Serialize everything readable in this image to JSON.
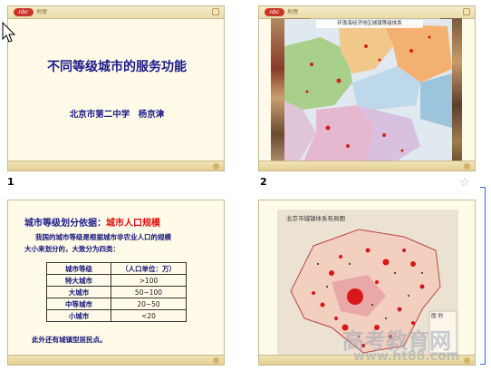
{
  "slides": [
    {
      "number": "1",
      "top_text": "地理",
      "logo": "nbc",
      "title": "不同等级城市的服务功能",
      "subtitle": "北京市第二中学　杨京津"
    },
    {
      "number": "2",
      "top_text": "地理",
      "logo": "nbc",
      "map_title": "环渤海经济地区城镇等级体系"
    },
    {
      "top_text": "地理",
      "logo": "nbc",
      "heading_prefix": "城市等级划分依据：",
      "heading_highlight": "城市人口规模",
      "para_line1": "我国的城市等级是根据城市非农业人口的规模",
      "para_line2": "大小来划分的，大致分为四类：",
      "table": {
        "header": [
          "城市等级",
          "（人口单位：万）"
        ],
        "rows": [
          [
            "特大城市",
            ">100"
          ],
          [
            "大城市",
            "50~100"
          ],
          [
            "中等城市",
            "20~50"
          ],
          [
            "小城市",
            "<20"
          ]
        ]
      },
      "footnote": "此外还有城镇型居民点。"
    },
    {
      "top_text": "地理",
      "logo": "nbc",
      "map_title": "北京市城镇体系布局图",
      "legend_label": "图 例"
    }
  ],
  "watermark": {
    "cn": "高考教育网",
    "url": "www.ht88.com"
  },
  "colors": {
    "slide_bg": "#fffbe8",
    "title_blue": "#1a1a8c",
    "highlight_red": "#e01010",
    "accent_red": "#c8362a"
  }
}
